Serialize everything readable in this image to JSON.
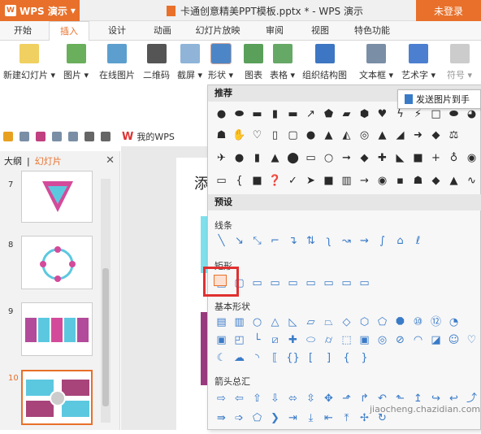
{
  "app": {
    "name": "WPS 演示",
    "doc_title": "卡通创意精美PPT模板.pptx * - WPS 演示",
    "login": "未登录"
  },
  "tabs": [
    "开始",
    "插入",
    "设计",
    "动画",
    "幻灯片放映",
    "审阅",
    "视图",
    "特色功能"
  ],
  "ribbon": {
    "new_slide": "新建幻灯片 ▾",
    "picture": "图片 ▾",
    "online_picture": "在线图片",
    "qrcode": "二维码",
    "screenshot": "截屏 ▾",
    "shape": "形状 ▾",
    "chart": "图表",
    "table": "表格 ▾",
    "org": "组织结构图",
    "textbox": "文本框 ▾",
    "art": "艺术字 ▾",
    "symbol": "符号 ▾"
  },
  "quickbar": {
    "mywps": "我的WPS"
  },
  "panel": {
    "tab_outline": "大纲",
    "tab_slides": "幻灯片",
    "sep": "|",
    "close": "✕",
    "thumbs": [
      "7",
      "8",
      "9",
      "10"
    ]
  },
  "slide": {
    "title_fragment": "添"
  },
  "dropdown": {
    "recommend": "推荐",
    "preset": "预设",
    "lines": "线条",
    "rect": "矩形",
    "basic": "基本形状",
    "arrows": "箭头总汇"
  },
  "tooltip": "发送图片到手",
  "watermark": "jiaocheng.chazidian.com",
  "colors": {
    "accent": "#e8702a",
    "highlight": "#e03030"
  }
}
